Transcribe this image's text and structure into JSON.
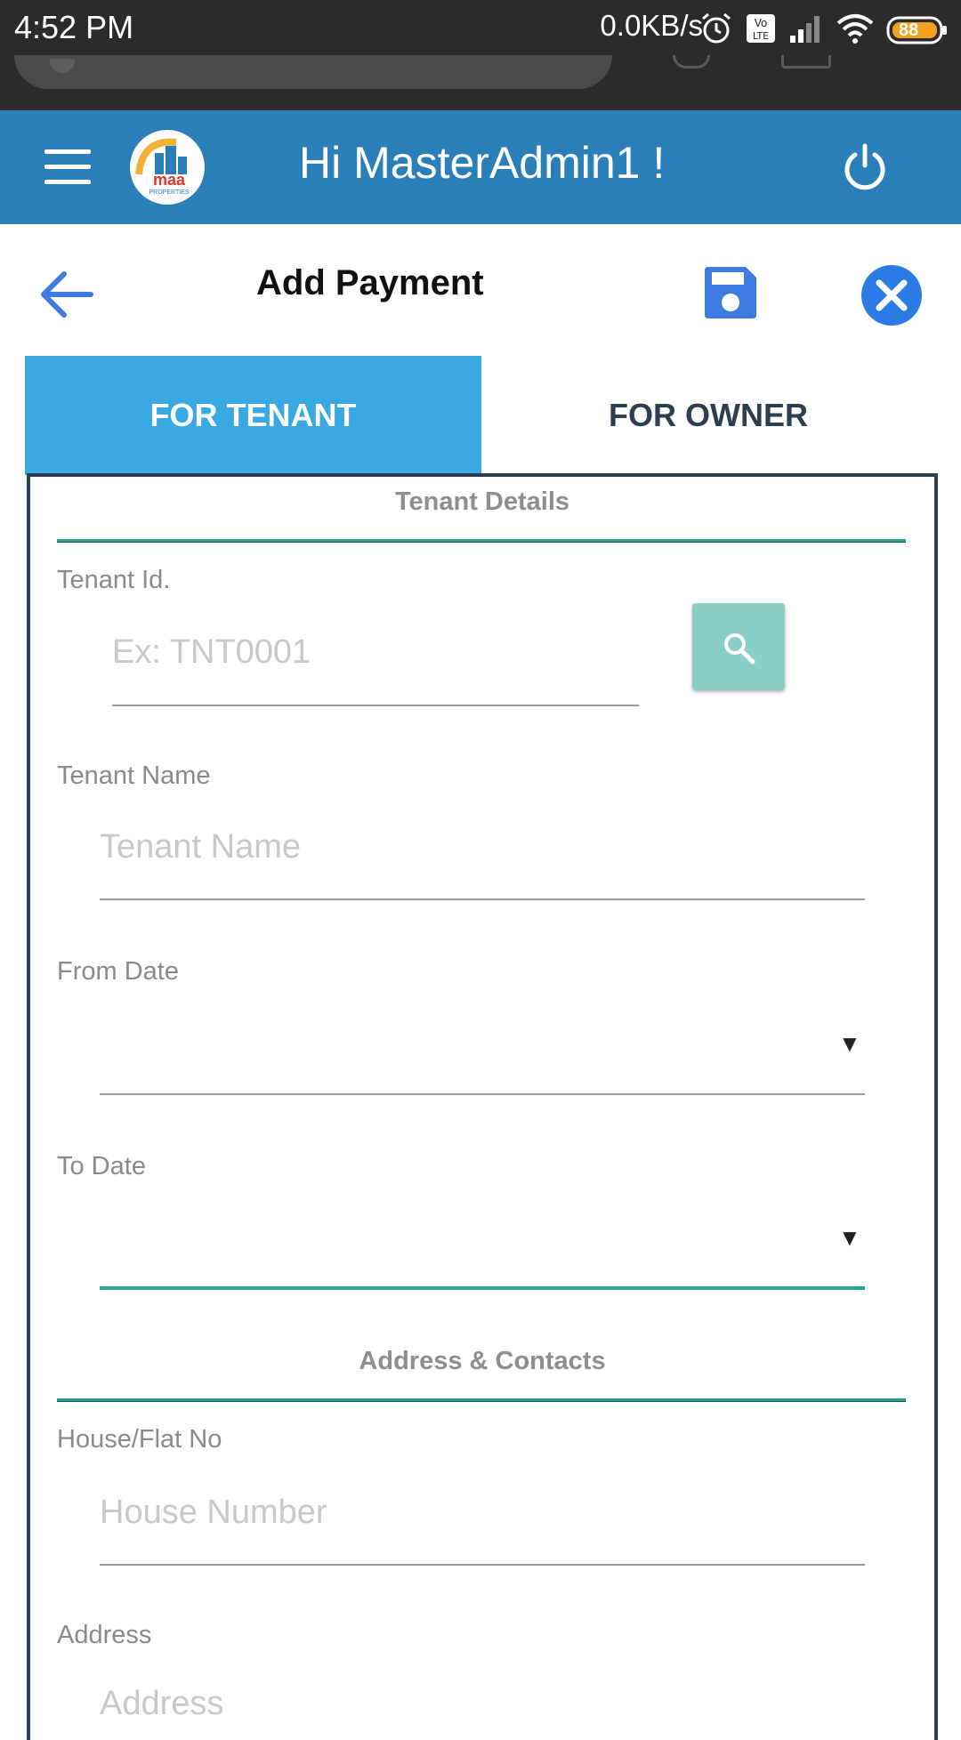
{
  "status_bar": {
    "time": "4:52 PM",
    "network_speed": "0.0KB/s",
    "battery": "88",
    "icons": [
      "alarm-icon",
      "volte-icon",
      "signal-icon",
      "wifi-icon",
      "battery-icon"
    ]
  },
  "app_bar": {
    "greeting": "Hi MasterAdmin1 !",
    "logo_text": "maa",
    "logo_subtext": "PROPERTIES",
    "menu_icon": "hamburger-icon",
    "power_icon": "power-icon"
  },
  "toolbar": {
    "title": "Add Payment",
    "back_icon": "arrow-left-icon",
    "save_icon": "floppy-disk-icon",
    "close_icon": "close-circle-icon"
  },
  "tabs": [
    {
      "label": "FOR TENANT",
      "active": true
    },
    {
      "label": "FOR OWNER",
      "active": false
    }
  ],
  "form": {
    "tenant_details": {
      "title": "Tenant Details",
      "tenant_id": {
        "label": "Tenant Id.",
        "placeholder": "Ex: TNT0001",
        "value": ""
      },
      "tenant_name": {
        "label": "Tenant Name",
        "placeholder": "Tenant Name",
        "value": ""
      },
      "from_date": {
        "label": "From Date",
        "value": "",
        "caret": "▼"
      },
      "to_date": {
        "label": "To Date",
        "value": "",
        "caret": "▼"
      }
    },
    "address_contacts": {
      "title": "Address & Contacts",
      "house_no": {
        "label": "House/Flat No",
        "placeholder": "House Number",
        "value": ""
      },
      "address": {
        "label": "Address",
        "placeholder": "Address",
        "value": ""
      }
    }
  },
  "colors": {
    "app_bar": "#2a7fb9",
    "active_tab": "#3aa9e3",
    "accent": "#27a08e",
    "icon_blue": "#3d7be0",
    "search_button": "#89cfc8"
  }
}
